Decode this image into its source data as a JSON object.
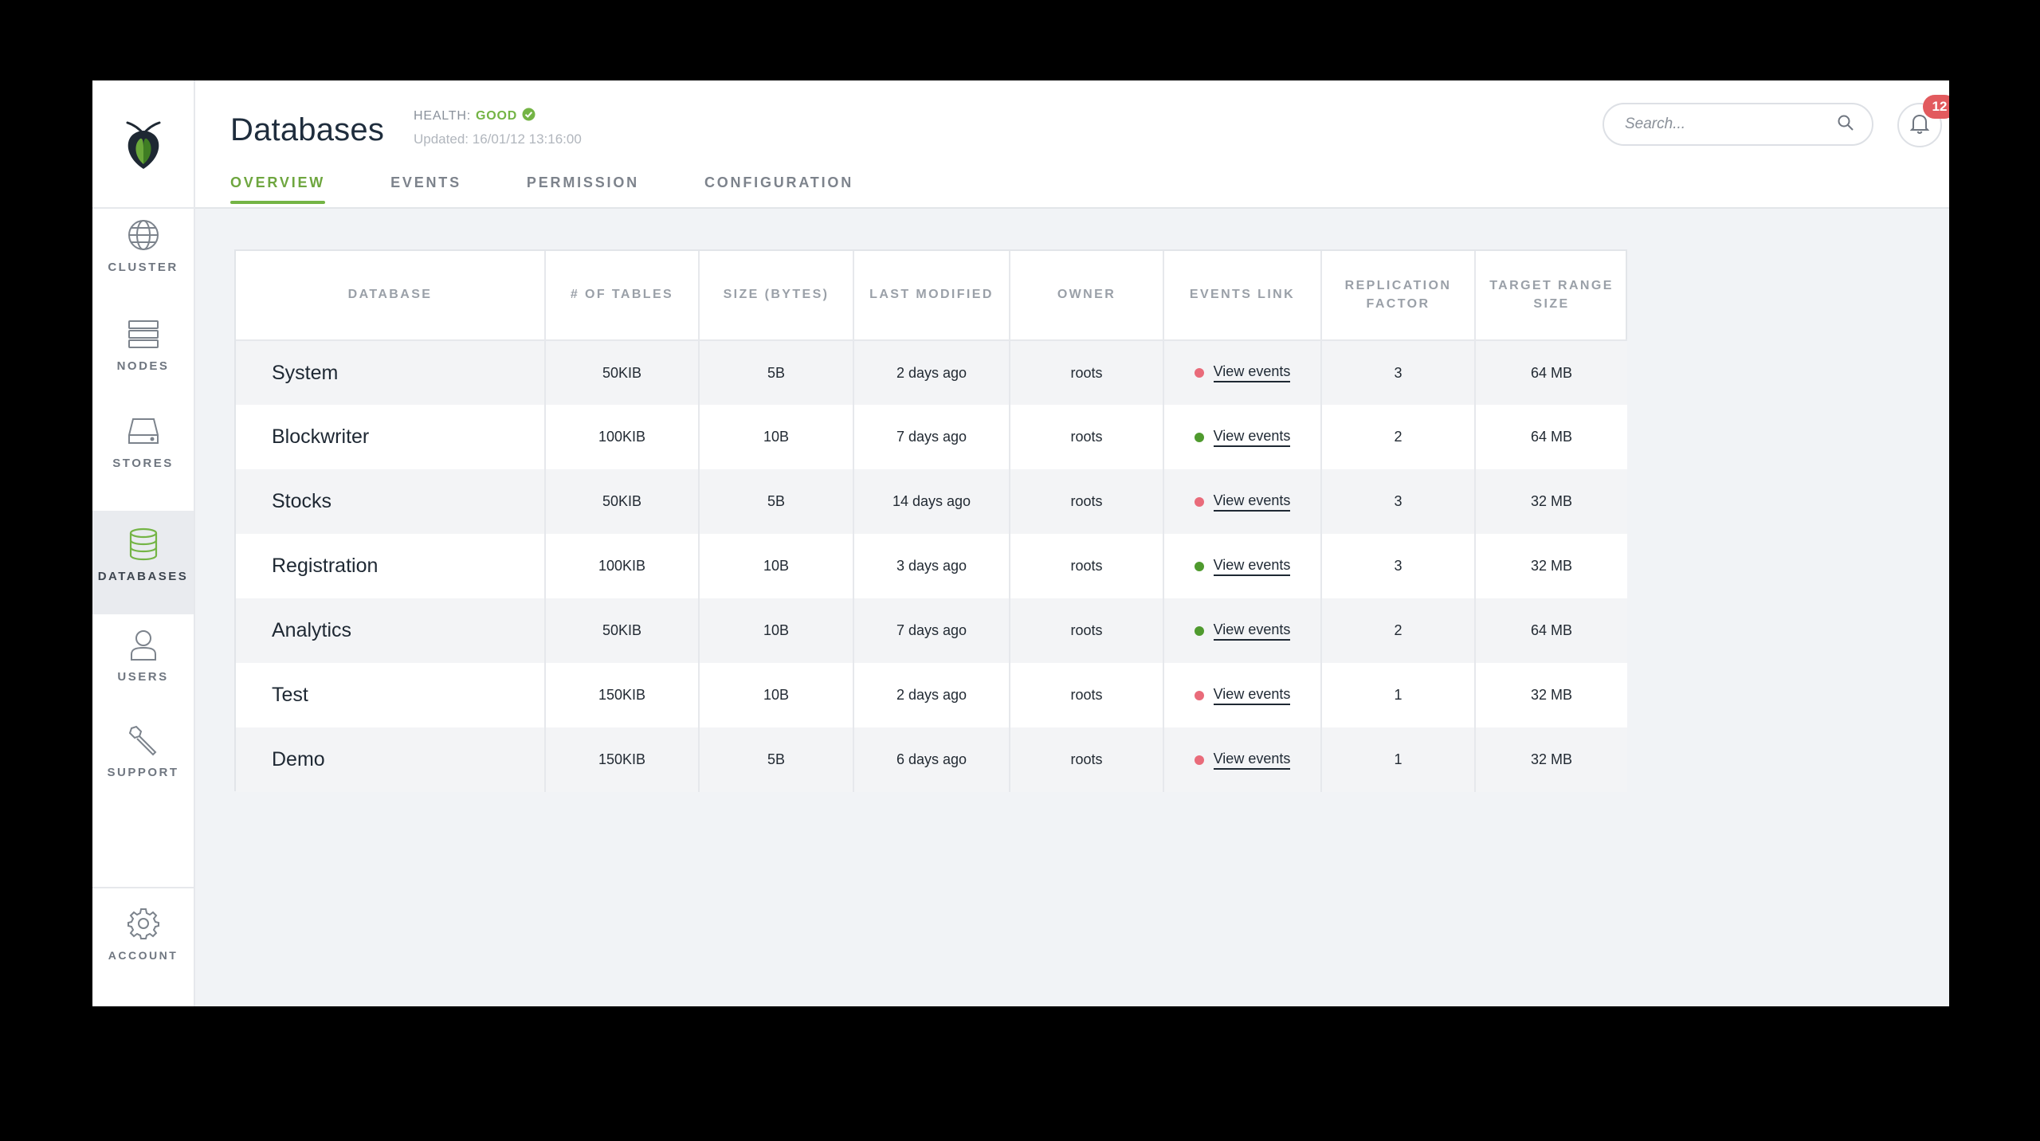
{
  "sidebar": {
    "items": [
      {
        "label": "CLUSTER",
        "icon": "globe-icon"
      },
      {
        "label": "NODES",
        "icon": "server-icon"
      },
      {
        "label": "STORES",
        "icon": "hard-drive-icon"
      },
      {
        "label": "DATABASES",
        "icon": "database-icon",
        "active": true
      },
      {
        "label": "USERS",
        "icon": "user-icon"
      },
      {
        "label": "SUPPORT",
        "icon": "wrench-icon"
      }
    ],
    "account": {
      "label": "ACCOUNT",
      "icon": "gear-icon"
    }
  },
  "header": {
    "title": "Databases",
    "health_label": "HEALTH:",
    "health_value": "GOOD",
    "updated_label": "Updated:",
    "updated_value": "16/01/12 13:16:00",
    "tabs": [
      {
        "label": "OVERVIEW",
        "active": true
      },
      {
        "label": "EVENTS"
      },
      {
        "label": "PERMISSION"
      },
      {
        "label": "CONFIGURATION"
      }
    ],
    "search_placeholder": "Search...",
    "notification_count": "12"
  },
  "colors": {
    "accent": "#74b445",
    "status_red": "#e96b7a",
    "status_green": "#4f9a2e",
    "badge": "#e25a5e"
  },
  "table": {
    "headers": [
      "DATABASE",
      "# OF TABLES",
      "SIZE (BYTES)",
      "LAST MODIFIED",
      "OWNER",
      "EVENTS LINK",
      "REPLICATION FACTOR",
      "TARGET RANGE SIZE"
    ],
    "rows": [
      {
        "name": "System",
        "tables": "50KIB",
        "size": "5B",
        "modified": "2 days ago",
        "owner": "roots",
        "events": "View events",
        "status": "red",
        "replication": "3",
        "range": "64 MB"
      },
      {
        "name": "Blockwriter",
        "tables": "100KIB",
        "size": "10B",
        "modified": "7 days ago",
        "owner": "roots",
        "events": "View events",
        "status": "green",
        "replication": "2",
        "range": "64 MB"
      },
      {
        "name": "Stocks",
        "tables": "50KIB",
        "size": "5B",
        "modified": "14 days ago",
        "owner": "roots",
        "events": "View events",
        "status": "red",
        "replication": "3",
        "range": "32 MB"
      },
      {
        "name": "Registration",
        "tables": "100KIB",
        "size": "10B",
        "modified": "3 days ago",
        "owner": "roots",
        "events": "View events",
        "status": "green",
        "replication": "3",
        "range": "32 MB"
      },
      {
        "name": "Analytics",
        "tables": "50KIB",
        "size": "10B",
        "modified": "7 days ago",
        "owner": "roots",
        "events": "View events",
        "status": "green",
        "replication": "2",
        "range": "64 MB"
      },
      {
        "name": "Test",
        "tables": "150KIB",
        "size": "10B",
        "modified": "2 days ago",
        "owner": "roots",
        "events": "View events",
        "status": "red",
        "replication": "1",
        "range": "32 MB"
      },
      {
        "name": "Demo",
        "tables": "150KIB",
        "size": "5B",
        "modified": "6 days ago",
        "owner": "roots",
        "events": "View events",
        "status": "red",
        "replication": "1",
        "range": "32 MB"
      }
    ]
  }
}
